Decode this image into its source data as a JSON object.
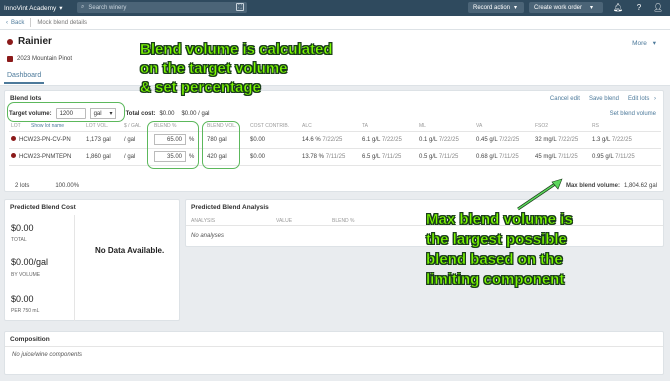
{
  "topbar": {
    "brand": "InnoVint Academy",
    "search_placeholder": "Search winery",
    "record_action": "Record action",
    "create_work_order": "Create work order"
  },
  "breadcrumb": {
    "back": "Back",
    "current": "Mock blend details"
  },
  "header": {
    "title": "Rainier",
    "vintage": "2023 Mountain Pinot",
    "more": "More",
    "tab": "Dashboard"
  },
  "blend_lots": {
    "title": "Blend lots",
    "cancel_edit": "Cancel edit",
    "save_blend": "Save blend",
    "edit_lots": "Edit lots",
    "target_volume_label": "Target volume:",
    "target_volume_value": "1200",
    "unit": "gal",
    "total_cost_label": "Total cost:",
    "total_cost_value": "$0.00",
    "cost_per_gal": "$0.00 / gal",
    "set_blend_volume": "Set blend volume",
    "columns": [
      "LOT",
      "Show lot name",
      "LOT VOL.",
      "$ / GAL",
      "BLEND %",
      "BLEND VOL.",
      "COST CONTRIB.",
      "ALC",
      "TA",
      "ML",
      "VA",
      "FSO2",
      "RS"
    ],
    "rows": [
      {
        "lot": "HCW23-PN-CV-PN",
        "lot_vol": "1,173 gal",
        "per_gal": "/ gal",
        "blend_pct": "65.00",
        "pct_sign": "%",
        "blend_vol": "780 gal",
        "cost": "$0.00",
        "alc": "14.6 %",
        "alc_date": "7/22/25",
        "ta": "6.1 g/L",
        "ta_date": "7/22/25",
        "ml": "0.1 g/L",
        "ml_date": "7/22/25",
        "va": "0.45 g/L",
        "va_date": "7/22/25",
        "fso2": "32 mg/L",
        "fso2_date": "7/22/25",
        "rs": "1.3 g/L",
        "rs_date": "7/22/25"
      },
      {
        "lot": "HCW23-PNMTEPN",
        "lot_vol": "1,860 gal",
        "per_gal": "/ gal",
        "blend_pct": "35.00",
        "pct_sign": "%",
        "blend_vol": "420 gal",
        "cost": "$0.00",
        "alc": "13.78 %",
        "alc_date": "7/11/25",
        "ta": "6.5 g/L",
        "ta_date": "7/11/25",
        "ml": "0.5 g/L",
        "ml_date": "7/11/25",
        "va": "0.68 g/L",
        "va_date": "7/11/25",
        "fso2": "45 mg/L",
        "fso2_date": "7/11/25",
        "rs": "0.95 g/L",
        "rs_date": "7/11/25"
      }
    ],
    "footer_lots": "2 lots",
    "footer_pct": "100.00%",
    "max_label": "Max blend volume:",
    "max_value": "1,804.62 gal"
  },
  "cost_panel": {
    "title": "Predicted Blend Cost",
    "total": "$0.00",
    "total_label": "TOTAL",
    "by_volume": "$0.00/gal",
    "by_volume_label": "BY VOLUME",
    "per_750": "$0.00",
    "per_750_label": "PER 750 mL",
    "no_data": "No Data Available."
  },
  "analysis_panel": {
    "title": "Predicted Blend Analysis",
    "columns": [
      "ANALYSIS",
      "VALUE",
      "BLEND %"
    ],
    "empty": "No analyses"
  },
  "composition": {
    "title": "Composition",
    "empty": "No juice/wine components"
  },
  "annotations": {
    "a1_l1": "Blend volume is calculated",
    "a1_l2": "on the target volume",
    "a1_l3": "& set percentage",
    "a2_l1": "Max blend volume is",
    "a2_l2": "the largest possible",
    "a2_l3": "blend based on the",
    "a2_l4": "limiting component"
  },
  "colors": {
    "topbar": "#2f4a5e",
    "link": "#4d7a9b",
    "annotation": "#7cfc00",
    "highlight": "#5cb85c",
    "wine": "#8b1a1a"
  }
}
